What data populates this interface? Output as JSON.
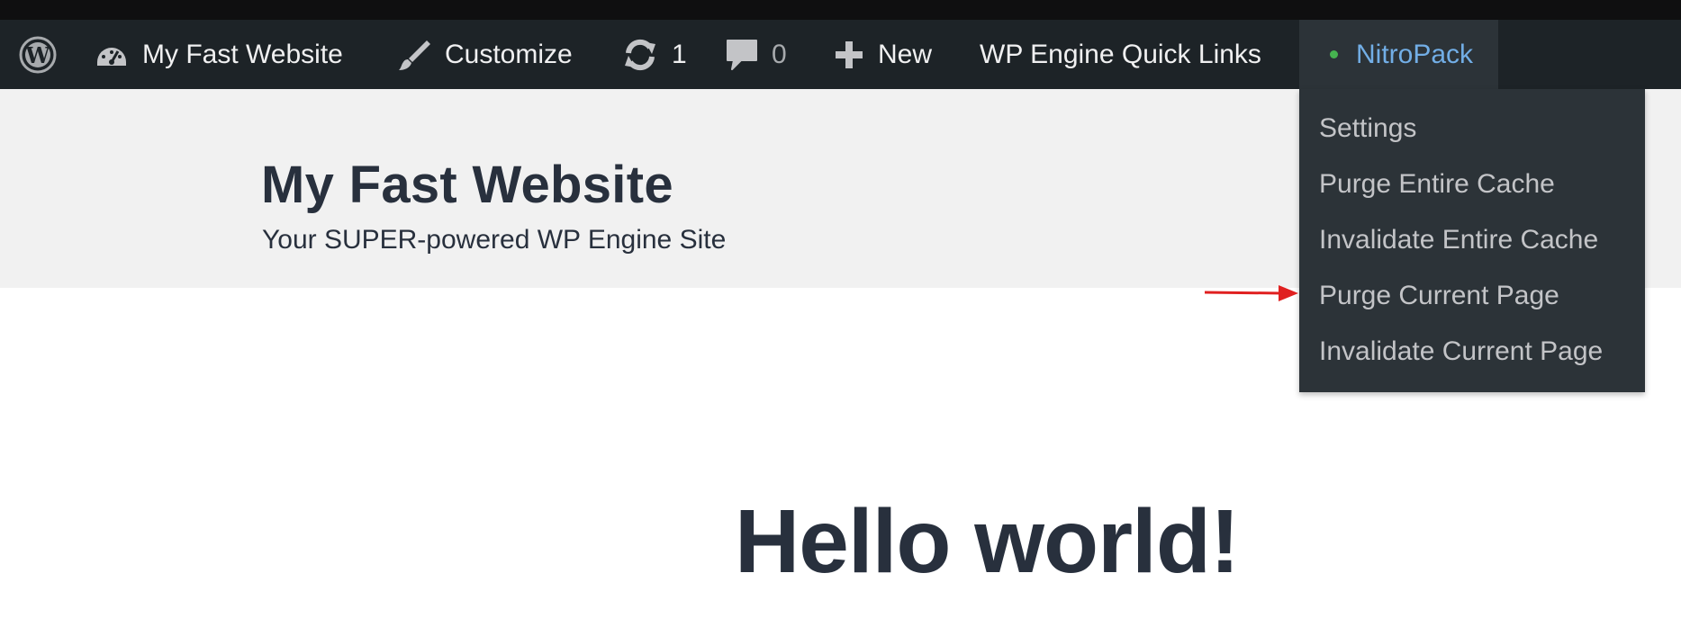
{
  "admin_bar": {
    "wp_logo_icon": "wordpress-icon",
    "site_name": "My Fast Website",
    "site_icon": "dashboard-icon",
    "customize_label": "Customize",
    "customize_icon": "paintbrush-icon",
    "updates_count": "1",
    "updates_icon": "updates-icon",
    "comments_count": "0",
    "comments_icon": "comment-icon",
    "new_label": "New",
    "new_icon": "plus-icon",
    "quick_links_label": "WP Engine Quick Links",
    "nitropack_label": "NitroPack",
    "nitropack_status_color": "#46b450"
  },
  "nitropack_menu": {
    "items": [
      "Settings",
      "Purge Entire Cache",
      "Invalidate Entire Cache",
      "Purge Current Page",
      "Invalidate Current Page"
    ]
  },
  "site_header": {
    "title": "My Fast Website",
    "description": "Your SUPER-powered WP Engine Site"
  },
  "post": {
    "title": "Hello world!"
  },
  "annotation": {
    "arrow_color": "#e02020"
  }
}
